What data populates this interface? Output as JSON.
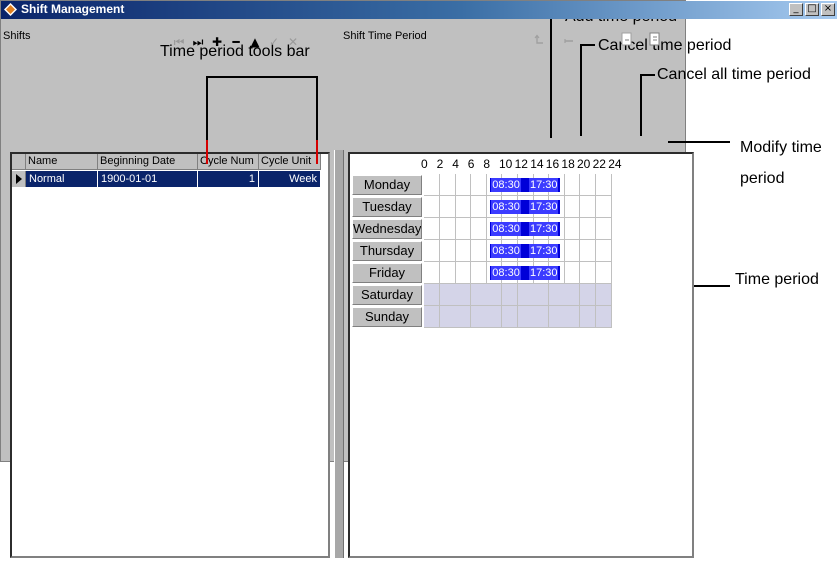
{
  "annotations": {
    "tools_bar": "Time period tools bar",
    "add_period": "Add time period",
    "cancel_period": "Cancel time period",
    "cancel_all": "Cancel all time period",
    "modify_line1": "Modify time",
    "modify_line2": "period",
    "time_period": "Time period"
  },
  "window": {
    "title": "Shift Management",
    "minimize": "_",
    "maximize": "□",
    "close": "×"
  },
  "shifts_panel": {
    "header": "Shifts",
    "tools": [
      {
        "name": "first-record-icon",
        "glyph": "⏮",
        "enabled": false
      },
      {
        "name": "last-record-icon",
        "glyph": "⏭",
        "enabled": true
      },
      {
        "name": "add-icon",
        "glyph": "✚",
        "enabled": true
      },
      {
        "name": "delete-icon",
        "glyph": "━",
        "enabled": true
      },
      {
        "name": "move-up-icon",
        "glyph": "▲",
        "enabled": true
      },
      {
        "name": "confirm-icon",
        "glyph": "✓",
        "enabled": false
      },
      {
        "name": "cancel-icon",
        "glyph": "✕",
        "enabled": false
      }
    ],
    "columns": [
      "Name",
      "Beginning Date",
      "Cycle Num",
      "Cycle Unit"
    ],
    "rows": [
      {
        "name": "Normal",
        "beginning_date": "1900-01-01",
        "cycle_num": "1",
        "cycle_unit": "Week"
      }
    ]
  },
  "period_panel": {
    "header": "Shift Time Period",
    "hours": [
      "0",
      "2",
      "4",
      "6",
      "8",
      "10",
      "12",
      "14",
      "16",
      "18",
      "20",
      "22",
      "24"
    ],
    "days": [
      {
        "label": "Monday",
        "start": "08:30",
        "end": "17:30",
        "start_h": 8.5,
        "end_h": 17.5,
        "weekend": false
      },
      {
        "label": "Tuesday",
        "start": "08:30",
        "end": "17:30",
        "start_h": 8.5,
        "end_h": 17.5,
        "weekend": false
      },
      {
        "label": "Wednesday",
        "start": "08:30",
        "end": "17:30",
        "start_h": 8.5,
        "end_h": 17.5,
        "weekend": false
      },
      {
        "label": "Thursday",
        "start": "08:30",
        "end": "17:30",
        "start_h": 8.5,
        "end_h": 17.5,
        "weekend": false
      },
      {
        "label": "Friday",
        "start": "08:30",
        "end": "17:30",
        "start_h": 8.5,
        "end_h": 17.5,
        "weekend": false
      },
      {
        "label": "Saturday",
        "start": "",
        "end": "",
        "start_h": null,
        "end_h": null,
        "weekend": true
      },
      {
        "label": "Sunday",
        "start": "",
        "end": "",
        "start_h": null,
        "end_h": null,
        "weekend": true
      }
    ]
  },
  "colors": {
    "selection": "#0a246a",
    "period_bar": "#0000d8",
    "weekend": "#d4d4e8",
    "tools_bar_marker": "#d40000"
  }
}
